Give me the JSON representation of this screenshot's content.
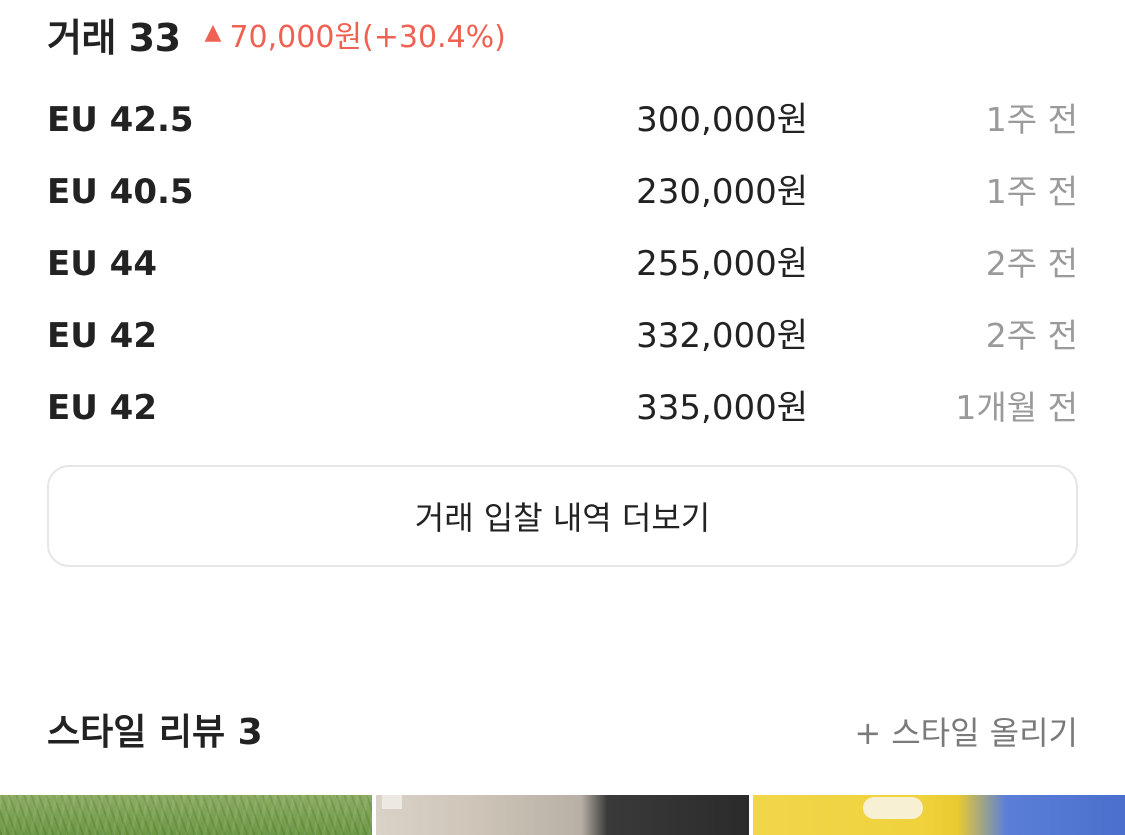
{
  "trades": {
    "title": "거래 33",
    "change_icon": "▲",
    "change_text": "70,000원(+30.4%)",
    "change_color": "#ef6253",
    "rows": [
      {
        "size": "EU 42.5",
        "price": "300,000원",
        "date": "1주 전"
      },
      {
        "size": "EU 40.5",
        "price": "230,000원",
        "date": "1주 전"
      },
      {
        "size": "EU 44",
        "price": "255,000원",
        "date": "2주 전"
      },
      {
        "size": "EU 42",
        "price": "332,000원",
        "date": "2주 전"
      },
      {
        "size": "EU 42",
        "price": "335,000원",
        "date": "1개월 전"
      }
    ],
    "more_button_label": "거래 입찰 내역 더보기"
  },
  "style_review": {
    "title": "스타일 리뷰 3",
    "upload_plus": "+",
    "upload_label": "스타일 올리기"
  }
}
